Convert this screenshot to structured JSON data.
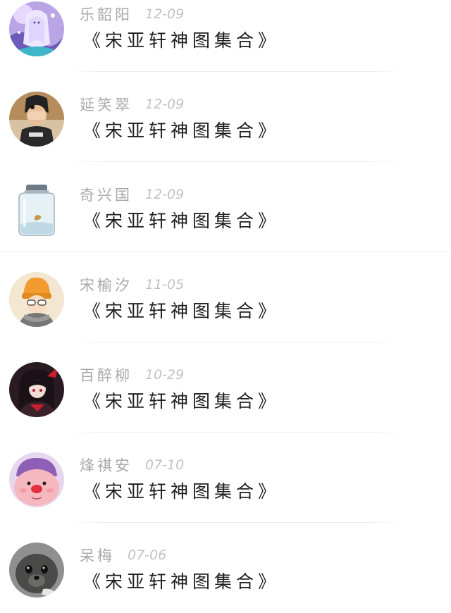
{
  "comments": [
    {
      "name": "乐韶阳",
      "date": "12-09",
      "text": "《宋亚轩神图集合》",
      "avatar": "anime-girl-purple-avatar"
    },
    {
      "name": "延笑翠",
      "date": "12-09",
      "text": "《宋亚轩神图集合》",
      "avatar": "boy-covering-face-avatar"
    },
    {
      "name": "奇兴国",
      "date": "12-09",
      "text": "《宋亚轩神图集合》",
      "avatar": "glass-jar-avatar"
    },
    {
      "name": "宋榆汐",
      "date": "11-05",
      "text": "《宋亚轩神图集合》",
      "avatar": "girl-orange-hat-avatar"
    },
    {
      "name": "百醉柳",
      "date": "10-29",
      "text": "《宋亚轩神图集合》",
      "avatar": "dark-anime-girl-avatar"
    },
    {
      "name": "烽祺安",
      "date": "07-10",
      "text": "《宋亚轩神图集合》",
      "avatar": "pink-plush-creature-avatar"
    },
    {
      "name": "呆梅",
      "date": "07-06",
      "text": "《宋亚轩神图集合》",
      "avatar": "seal-avatar"
    }
  ],
  "colors": {
    "name": "#a9a9a9",
    "date": "#c2c2c2",
    "text": "#1e1e1e",
    "divider": "#ececec"
  }
}
